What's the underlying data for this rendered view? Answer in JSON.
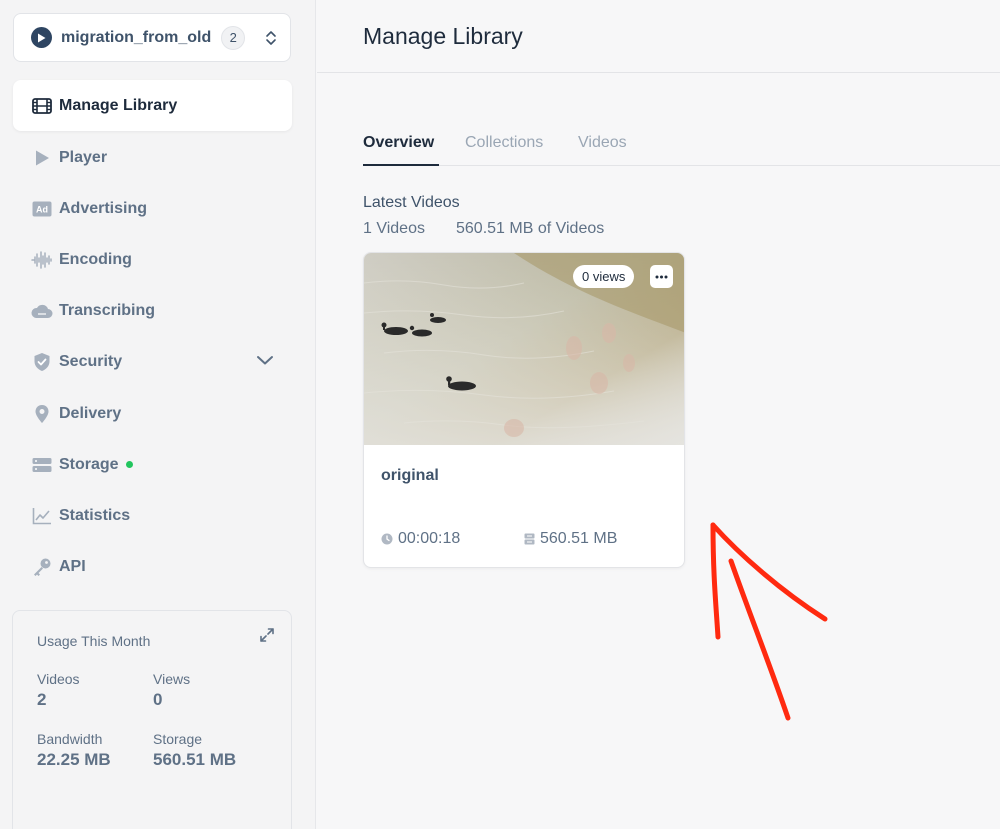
{
  "library": {
    "name": "migration_from_old",
    "count": "2"
  },
  "nav": [
    {
      "id": "manage-library",
      "label": "Manage Library",
      "icon": "film-icon",
      "active": true
    },
    {
      "id": "player",
      "label": "Player",
      "icon": "play-icon"
    },
    {
      "id": "advertising",
      "label": "Advertising",
      "icon": "ad-icon"
    },
    {
      "id": "encoding",
      "label": "Encoding",
      "icon": "waveform-icon"
    },
    {
      "id": "transcribing",
      "label": "Transcribing",
      "icon": "cloud-icon"
    },
    {
      "id": "security",
      "label": "Security",
      "icon": "shield-icon"
    },
    {
      "id": "delivery",
      "label": "Delivery",
      "icon": "location-pin-icon"
    },
    {
      "id": "storage",
      "label": "Storage",
      "icon": "server-icon"
    },
    {
      "id": "statistics",
      "label": "Statistics",
      "icon": "chart-icon"
    },
    {
      "id": "api",
      "label": "API",
      "icon": "key-icon"
    }
  ],
  "usage": {
    "title": "Usage This Month",
    "videos_label": "Videos",
    "videos_value": "2",
    "views_label": "Views",
    "views_value": "0",
    "bandwidth_label": "Bandwidth",
    "bandwidth_value": "22.25 MB",
    "storage_label": "Storage",
    "storage_value": "560.51 MB"
  },
  "header": {
    "title": "Manage Library"
  },
  "tabs": [
    {
      "label": "Overview",
      "active": true
    },
    {
      "label": "Collections"
    },
    {
      "label": "Videos"
    }
  ],
  "overview": {
    "heading": "Latest Videos",
    "video_count": "1 Videos",
    "total_size": "560.51 MB of Videos"
  },
  "video": {
    "views": "0 views",
    "title": "original",
    "duration": "00:00:18",
    "size": "560.51 MB"
  },
  "colors": {
    "accent": "#1e2b3c",
    "muted": "#5f7186",
    "status_dot": "#22c55e",
    "annotation_arrow": "#ff2a10"
  }
}
